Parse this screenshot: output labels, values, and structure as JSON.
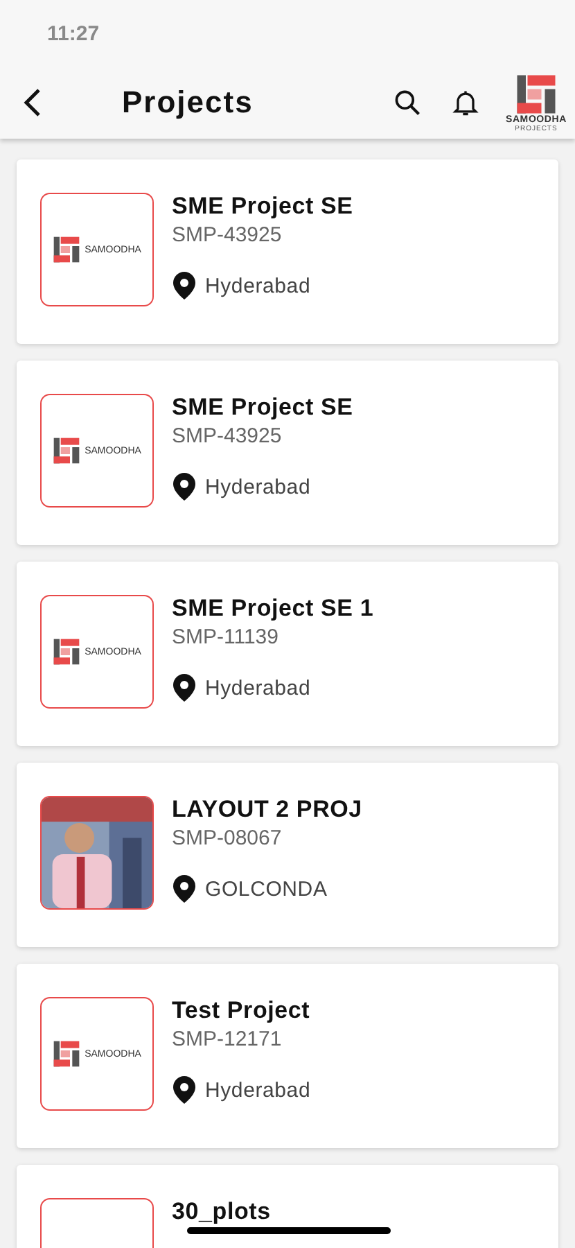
{
  "status_bar": {
    "time": "11:27"
  },
  "header": {
    "title": "Projects",
    "logo": {
      "name": "SAMOODHA",
      "tagline": "PROJECTS"
    }
  },
  "projects": [
    {
      "name": "SME Project SE",
      "code": "SMP-43925",
      "location": "Hyderabad",
      "thumbnail": {
        "kind": "logo",
        "text": "SAMOODHA"
      }
    },
    {
      "name": "SME Project SE",
      "code": "SMP-43925",
      "location": "Hyderabad",
      "thumbnail": {
        "kind": "logo",
        "text": "SAMOODHA"
      }
    },
    {
      "name": "SME Project SE 1",
      "code": "SMP-11139",
      "location": "Hyderabad",
      "thumbnail": {
        "kind": "logo",
        "text": "SAMOODHA"
      }
    },
    {
      "name": "LAYOUT 2 PROJ",
      "code": "SMP-08067",
      "location": "GOLCONDA"
    },
    {
      "name": "Test Project",
      "code": "SMP-12171",
      "location": "Hyderabad",
      "thumbnail": {
        "kind": "logo",
        "text": "SAMOODHA"
      }
    },
    {
      "name": "30_plots",
      "thumbnail": {
        "kind": "blank"
      }
    }
  ]
}
